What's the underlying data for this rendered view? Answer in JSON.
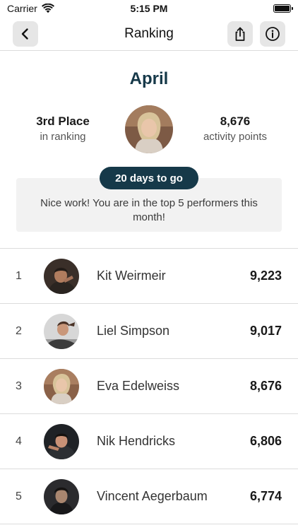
{
  "status_bar": {
    "carrier": "Carrier",
    "time": "5:15 PM",
    "battery_level": 1.0
  },
  "nav": {
    "title": "Ranking",
    "back_icon": "chevron-left-icon",
    "share_icon": "share-icon",
    "info_icon": "info-icon"
  },
  "summary": {
    "month": "April",
    "place": "3rd Place",
    "place_caption": "in ranking",
    "points": "8,676",
    "points_caption": "activity points",
    "days_left": "20 days to go",
    "message": "Nice work! You are in the top 5 performers this month!"
  },
  "colors": {
    "accent": "#163949",
    "notice_background": "#f2f2f2",
    "nav_button_background": "#e6e6e6"
  },
  "ranking": [
    {
      "position": "1",
      "name": "Kit Weirmeir",
      "points": "9,223"
    },
    {
      "position": "2",
      "name": "Liel Simpson",
      "points": "9,017"
    },
    {
      "position": "3",
      "name": "Eva Edelweiss",
      "points": "8,676"
    },
    {
      "position": "4",
      "name": "Nik Hendricks",
      "points": "6,806"
    },
    {
      "position": "5",
      "name": "Vincent Aegerbaum",
      "points": "6,774"
    }
  ]
}
